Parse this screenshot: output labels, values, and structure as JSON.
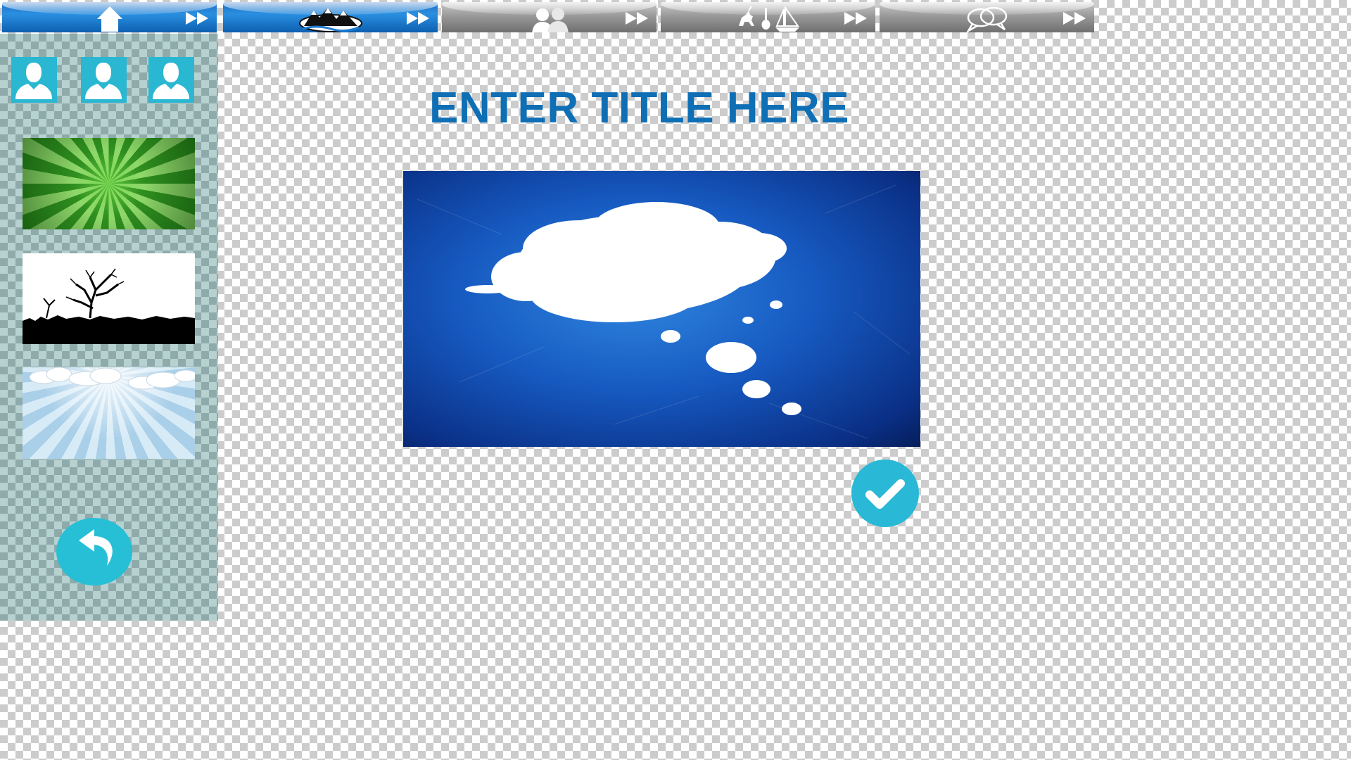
{
  "tabs": [
    {
      "name": "home",
      "icon": "house-icon",
      "style": "active"
    },
    {
      "name": "scenery",
      "icon": "mountains-icon",
      "style": "active"
    },
    {
      "name": "people",
      "icon": "people-icon",
      "style": "inactive"
    },
    {
      "name": "objects",
      "icon": "unicorn-guitar-sailboat-icon",
      "style": "inactive"
    },
    {
      "name": "speech",
      "icon": "speech-bubbles-icon",
      "style": "inactive"
    }
  ],
  "sidebar": {
    "avatars": [
      "person-icon",
      "person-icon",
      "person-icon"
    ],
    "backgrounds": [
      "green-sunburst",
      "tree-silhouette",
      "sky-clouds"
    ]
  },
  "main": {
    "title": "ENTER TITLE HERE",
    "canvas_background": "blue-thought-cloud"
  },
  "colors": {
    "accent": "#29b8d6",
    "title": "#0f6fb5",
    "tab_active": "#1f6fc4",
    "tab_inactive": "#9a9a9a"
  }
}
